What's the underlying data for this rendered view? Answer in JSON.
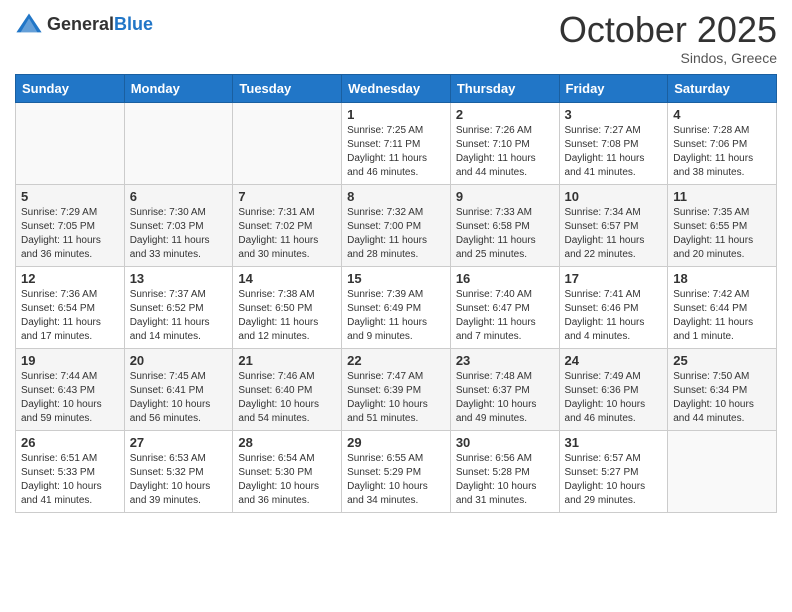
{
  "header": {
    "logo_general": "General",
    "logo_blue": "Blue",
    "month_title": "October 2025",
    "subtitle": "Sindos, Greece"
  },
  "days_of_week": [
    "Sunday",
    "Monday",
    "Tuesday",
    "Wednesday",
    "Thursday",
    "Friday",
    "Saturday"
  ],
  "weeks": [
    [
      {
        "day": "",
        "info": ""
      },
      {
        "day": "",
        "info": ""
      },
      {
        "day": "",
        "info": ""
      },
      {
        "day": "1",
        "info": "Sunrise: 7:25 AM\nSunset: 7:11 PM\nDaylight: 11 hours and 46 minutes."
      },
      {
        "day": "2",
        "info": "Sunrise: 7:26 AM\nSunset: 7:10 PM\nDaylight: 11 hours and 44 minutes."
      },
      {
        "day": "3",
        "info": "Sunrise: 7:27 AM\nSunset: 7:08 PM\nDaylight: 11 hours and 41 minutes."
      },
      {
        "day": "4",
        "info": "Sunrise: 7:28 AM\nSunset: 7:06 PM\nDaylight: 11 hours and 38 minutes."
      }
    ],
    [
      {
        "day": "5",
        "info": "Sunrise: 7:29 AM\nSunset: 7:05 PM\nDaylight: 11 hours and 36 minutes."
      },
      {
        "day": "6",
        "info": "Sunrise: 7:30 AM\nSunset: 7:03 PM\nDaylight: 11 hours and 33 minutes."
      },
      {
        "day": "7",
        "info": "Sunrise: 7:31 AM\nSunset: 7:02 PM\nDaylight: 11 hours and 30 minutes."
      },
      {
        "day": "8",
        "info": "Sunrise: 7:32 AM\nSunset: 7:00 PM\nDaylight: 11 hours and 28 minutes."
      },
      {
        "day": "9",
        "info": "Sunrise: 7:33 AM\nSunset: 6:58 PM\nDaylight: 11 hours and 25 minutes."
      },
      {
        "day": "10",
        "info": "Sunrise: 7:34 AM\nSunset: 6:57 PM\nDaylight: 11 hours and 22 minutes."
      },
      {
        "day": "11",
        "info": "Sunrise: 7:35 AM\nSunset: 6:55 PM\nDaylight: 11 hours and 20 minutes."
      }
    ],
    [
      {
        "day": "12",
        "info": "Sunrise: 7:36 AM\nSunset: 6:54 PM\nDaylight: 11 hours and 17 minutes."
      },
      {
        "day": "13",
        "info": "Sunrise: 7:37 AM\nSunset: 6:52 PM\nDaylight: 11 hours and 14 minutes."
      },
      {
        "day": "14",
        "info": "Sunrise: 7:38 AM\nSunset: 6:50 PM\nDaylight: 11 hours and 12 minutes."
      },
      {
        "day": "15",
        "info": "Sunrise: 7:39 AM\nSunset: 6:49 PM\nDaylight: 11 hours and 9 minutes."
      },
      {
        "day": "16",
        "info": "Sunrise: 7:40 AM\nSunset: 6:47 PM\nDaylight: 11 hours and 7 minutes."
      },
      {
        "day": "17",
        "info": "Sunrise: 7:41 AM\nSunset: 6:46 PM\nDaylight: 11 hours and 4 minutes."
      },
      {
        "day": "18",
        "info": "Sunrise: 7:42 AM\nSunset: 6:44 PM\nDaylight: 11 hours and 1 minute."
      }
    ],
    [
      {
        "day": "19",
        "info": "Sunrise: 7:44 AM\nSunset: 6:43 PM\nDaylight: 10 hours and 59 minutes."
      },
      {
        "day": "20",
        "info": "Sunrise: 7:45 AM\nSunset: 6:41 PM\nDaylight: 10 hours and 56 minutes."
      },
      {
        "day": "21",
        "info": "Sunrise: 7:46 AM\nSunset: 6:40 PM\nDaylight: 10 hours and 54 minutes."
      },
      {
        "day": "22",
        "info": "Sunrise: 7:47 AM\nSunset: 6:39 PM\nDaylight: 10 hours and 51 minutes."
      },
      {
        "day": "23",
        "info": "Sunrise: 7:48 AM\nSunset: 6:37 PM\nDaylight: 10 hours and 49 minutes."
      },
      {
        "day": "24",
        "info": "Sunrise: 7:49 AM\nSunset: 6:36 PM\nDaylight: 10 hours and 46 minutes."
      },
      {
        "day": "25",
        "info": "Sunrise: 7:50 AM\nSunset: 6:34 PM\nDaylight: 10 hours and 44 minutes."
      }
    ],
    [
      {
        "day": "26",
        "info": "Sunrise: 6:51 AM\nSunset: 5:33 PM\nDaylight: 10 hours and 41 minutes."
      },
      {
        "day": "27",
        "info": "Sunrise: 6:53 AM\nSunset: 5:32 PM\nDaylight: 10 hours and 39 minutes."
      },
      {
        "day": "28",
        "info": "Sunrise: 6:54 AM\nSunset: 5:30 PM\nDaylight: 10 hours and 36 minutes."
      },
      {
        "day": "29",
        "info": "Sunrise: 6:55 AM\nSunset: 5:29 PM\nDaylight: 10 hours and 34 minutes."
      },
      {
        "day": "30",
        "info": "Sunrise: 6:56 AM\nSunset: 5:28 PM\nDaylight: 10 hours and 31 minutes."
      },
      {
        "day": "31",
        "info": "Sunrise: 6:57 AM\nSunset: 5:27 PM\nDaylight: 10 hours and 29 minutes."
      },
      {
        "day": "",
        "info": ""
      }
    ]
  ]
}
